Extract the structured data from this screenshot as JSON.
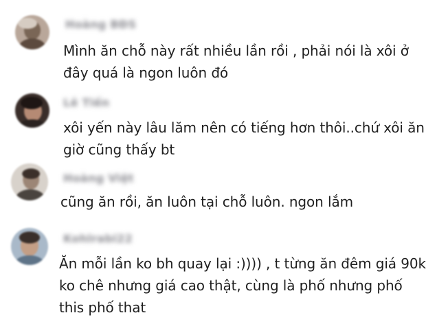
{
  "comments": [
    {
      "username": "Hoàng BĐS",
      "avatar_icon": "user-avatar-icon",
      "lines": [
        "Mình ăn chỗ này rất nhiều lần rồi , phải nói là xôi ở",
        "đây quá là ngon luôn đó"
      ]
    },
    {
      "username": "Lê Tiến",
      "avatar_icon": "user-avatar-icon",
      "lines": [
        "xôi yến này lâu lăm nên có tiếng hơn thôi..chứ xôi ăn",
        "giờ cũng thấy bt"
      ]
    },
    {
      "username": "Hoàng Việt",
      "avatar_icon": "user-avatar-icon",
      "lines": [
        "cũng ăn rồi, ăn luôn tại chỗ luôn. ngon lắm"
      ]
    },
    {
      "username": "Kohlrabi22",
      "avatar_icon": "user-avatar-icon",
      "lines": [
        "Ăn mỗi lần ko bh quay lại :)))) , t từng ăn đêm giá 90k,",
        "ko chê nhưng giá cao thật, cùng là phố nhưng phố",
        "this phố that"
      ]
    }
  ]
}
